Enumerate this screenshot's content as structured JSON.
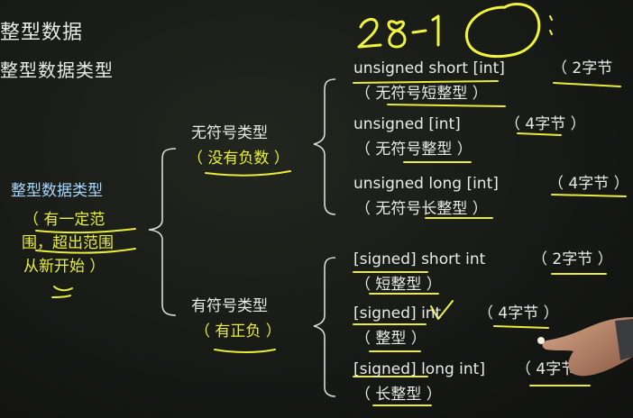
{
  "title": "整型数据",
  "subtitle": "整型数据类型",
  "root": {
    "label": "整型数据类型",
    "note_lines": [
      "（ 有一定范",
      "围，超出范围",
      "从新开始 ）"
    ]
  },
  "unsigned": {
    "label": "无符号类型",
    "note": "（ 没有负数 ）",
    "items": [
      {
        "type": "unsigned short  [int]",
        "size": "（ 2字节",
        "desc": "（ 无符号短整型 ）"
      },
      {
        "type": "unsigned [int]",
        "size": "（ 4字节 ）",
        "desc": "（ 无符号整型 ）"
      },
      {
        "type": "unsigned long  [int]",
        "size": "（ 4字节 ）",
        "desc": "（ 无符号长整型 ）"
      }
    ]
  },
  "signed": {
    "label": "有符号类型",
    "note": "（ 有正负 ）",
    "items": [
      {
        "type": "[signed] short  int",
        "size": "（ 2字节 ）",
        "desc": "（ 短整型 ）"
      },
      {
        "type": "[signed] int",
        "size": "（ 4字节 ）",
        "desc": "（ 整型 ）"
      },
      {
        "type": "[signed] long  int]",
        "size": "（ 4字节 ）",
        "desc": "（ 长整型 ）"
      }
    ]
  },
  "handwriting": "2⁸-1"
}
